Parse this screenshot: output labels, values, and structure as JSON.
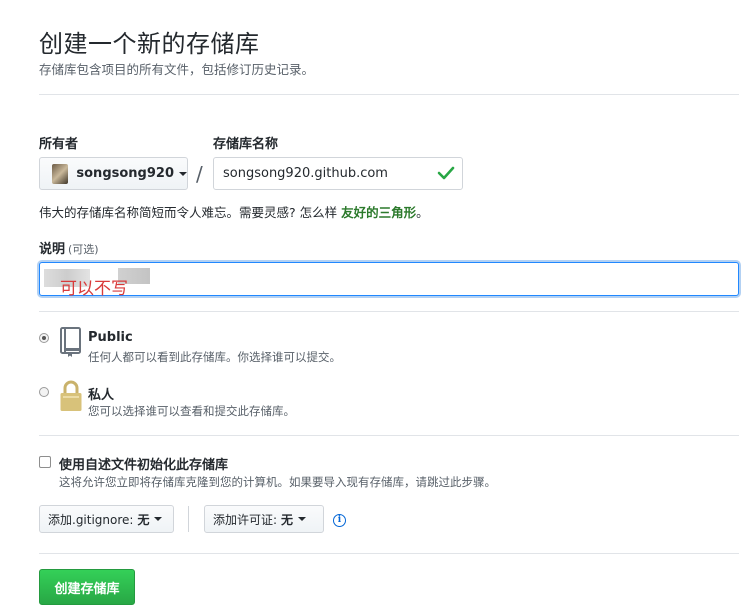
{
  "header": {
    "title": "创建一个新的存储库",
    "subtitle": "存储库包含项目的所有文件，包括修订历史记录。"
  },
  "owner": {
    "label": "所有者",
    "name": "songsong920"
  },
  "repo": {
    "label": "存储库名称",
    "value": "songsong920.github.com",
    "separator": "/"
  },
  "hint": {
    "text": "伟大的存储库名称简短而令人难忘。需要灵感? 怎么样 ",
    "suggestion": "友好的三角形",
    "end": "。"
  },
  "description": {
    "label": "说明",
    "optional": "(可选)",
    "value": "",
    "annotation": "可以不写"
  },
  "visibility": {
    "public_title": "Public",
    "public_desc": "任何人都可以看到此存储库。你选择谁可以提交。",
    "private_title": "私人",
    "private_desc": "您可以选择谁可以查看和提交此存储库。",
    "selected": "public"
  },
  "init": {
    "title": "使用自述文件初始化此存储库",
    "desc": "这将允许您立即将存储库克隆到您的计算机。如果要导入现有存储库，请跳过此步骤。",
    "checked": false
  },
  "gitignore": {
    "label": "添加.gitignore:",
    "value": "无"
  },
  "license": {
    "label": "添加许可证:",
    "value": "无"
  },
  "submit": {
    "label": "创建存储库"
  },
  "colors": {
    "accent_green": "#28a745",
    "focus_blue": "#2188ff",
    "annotation_red": "#d93b3b"
  },
  "icons": {
    "valid": "check-icon",
    "public": "repo-book-icon",
    "private": "lock-icon",
    "info": "info-icon"
  }
}
